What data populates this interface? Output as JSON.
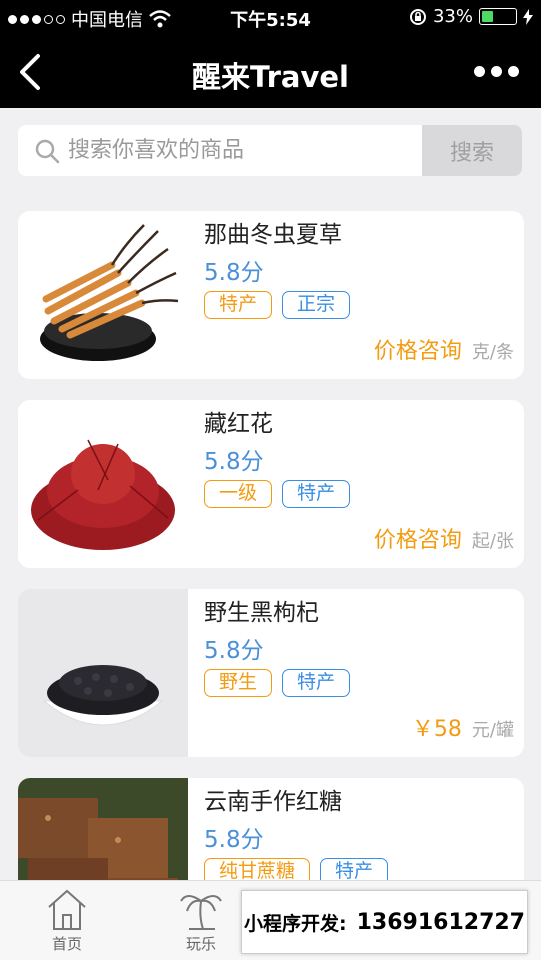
{
  "status_bar": {
    "carrier": "中国电信",
    "time": "下午5:54",
    "battery_pct": "33%",
    "battery_level": 0.33,
    "signal_dots_filled": 3,
    "signal_dots_total": 5
  },
  "nav": {
    "title": "醒来Travel"
  },
  "search": {
    "placeholder": "搜索你喜欢的商品",
    "button_label": "搜索"
  },
  "products": [
    {
      "name": "那曲冬虫夏草",
      "score": "5.8分",
      "tags": [
        {
          "label": "特产",
          "color": "orange"
        },
        {
          "label": "正宗",
          "color": "blue"
        }
      ],
      "price": "价格咨询",
      "unit": "克/条"
    },
    {
      "name": "藏红花",
      "score": "5.8分",
      "tags": [
        {
          "label": "一级",
          "color": "orange"
        },
        {
          "label": "特产",
          "color": "blue"
        }
      ],
      "price": "价格咨询",
      "unit": "起/张"
    },
    {
      "name": "野生黑枸杞",
      "score": "5.8分",
      "tags": [
        {
          "label": "野生",
          "color": "orange"
        },
        {
          "label": "特产",
          "color": "blue"
        }
      ],
      "price": "￥58",
      "unit": "元/罐"
    },
    {
      "name": "云南手作红糖",
      "score": "5.8分",
      "tags": [
        {
          "label": "纯甘蔗糖",
          "color": "orange"
        },
        {
          "label": "特产",
          "color": "blue"
        }
      ],
      "price": "",
      "unit": ""
    }
  ],
  "tabs": [
    {
      "label": "首页",
      "icon": "home-icon"
    },
    {
      "label": "玩乐",
      "icon": "palm-tree-icon"
    }
  ],
  "overlay": {
    "label": "小程序开发:",
    "phone": "13691612727"
  },
  "colors": {
    "accent_orange": "#f39c12",
    "accent_blue": "#3a8ee6",
    "score_blue": "#4a90d9",
    "bar_black": "#000000"
  }
}
